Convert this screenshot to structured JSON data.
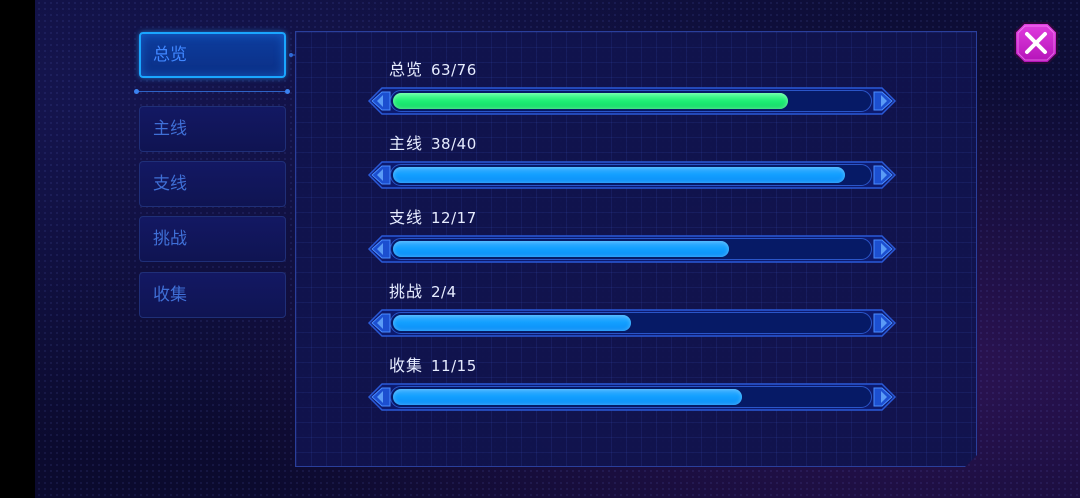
{
  "sidebar": {
    "tabs": [
      {
        "label": "总览",
        "active": true
      },
      {
        "label": "主线",
        "active": false
      },
      {
        "label": "支线",
        "active": false
      },
      {
        "label": "挑战",
        "active": false
      },
      {
        "label": "收集",
        "active": false
      }
    ]
  },
  "progress": [
    {
      "name": "总览",
      "count": "63/76",
      "fraction": 0.829,
      "color": "green"
    },
    {
      "name": "主线",
      "count": "38/40",
      "fraction": 0.95,
      "color": "blue"
    },
    {
      "name": "支线",
      "count": "12/17",
      "fraction": 0.706,
      "color": "blue"
    },
    {
      "name": "挑战",
      "count": "2/4",
      "fraction": 0.5,
      "color": "blue"
    },
    {
      "name": "收集",
      "count": "11/15",
      "fraction": 0.733,
      "color": "blue"
    }
  ],
  "close_icon": "close-x-icon",
  "colors": {
    "accent": "#1aa6ff",
    "green_fill": "#1fee75",
    "blue_fill": "#14a0ff",
    "close_button": "#d81fd6"
  }
}
